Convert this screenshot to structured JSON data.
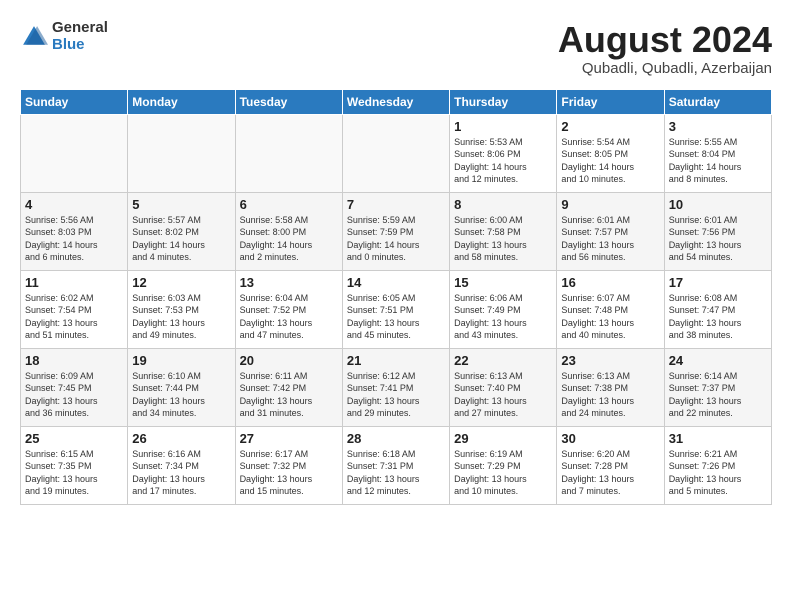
{
  "logo": {
    "general": "General",
    "blue": "Blue"
  },
  "title": "August 2024",
  "subtitle": "Qubadli, Qubadli, Azerbaijan",
  "weekdays": [
    "Sunday",
    "Monday",
    "Tuesday",
    "Wednesday",
    "Thursday",
    "Friday",
    "Saturday"
  ],
  "weeks": [
    [
      {
        "day": "",
        "info": ""
      },
      {
        "day": "",
        "info": ""
      },
      {
        "day": "",
        "info": ""
      },
      {
        "day": "",
        "info": ""
      },
      {
        "day": "1",
        "info": "Sunrise: 5:53 AM\nSunset: 8:06 PM\nDaylight: 14 hours\nand 12 minutes."
      },
      {
        "day": "2",
        "info": "Sunrise: 5:54 AM\nSunset: 8:05 PM\nDaylight: 14 hours\nand 10 minutes."
      },
      {
        "day": "3",
        "info": "Sunrise: 5:55 AM\nSunset: 8:04 PM\nDaylight: 14 hours\nand 8 minutes."
      }
    ],
    [
      {
        "day": "4",
        "info": "Sunrise: 5:56 AM\nSunset: 8:03 PM\nDaylight: 14 hours\nand 6 minutes."
      },
      {
        "day": "5",
        "info": "Sunrise: 5:57 AM\nSunset: 8:02 PM\nDaylight: 14 hours\nand 4 minutes."
      },
      {
        "day": "6",
        "info": "Sunrise: 5:58 AM\nSunset: 8:00 PM\nDaylight: 14 hours\nand 2 minutes."
      },
      {
        "day": "7",
        "info": "Sunrise: 5:59 AM\nSunset: 7:59 PM\nDaylight: 14 hours\nand 0 minutes."
      },
      {
        "day": "8",
        "info": "Sunrise: 6:00 AM\nSunset: 7:58 PM\nDaylight: 13 hours\nand 58 minutes."
      },
      {
        "day": "9",
        "info": "Sunrise: 6:01 AM\nSunset: 7:57 PM\nDaylight: 13 hours\nand 56 minutes."
      },
      {
        "day": "10",
        "info": "Sunrise: 6:01 AM\nSunset: 7:56 PM\nDaylight: 13 hours\nand 54 minutes."
      }
    ],
    [
      {
        "day": "11",
        "info": "Sunrise: 6:02 AM\nSunset: 7:54 PM\nDaylight: 13 hours\nand 51 minutes."
      },
      {
        "day": "12",
        "info": "Sunrise: 6:03 AM\nSunset: 7:53 PM\nDaylight: 13 hours\nand 49 minutes."
      },
      {
        "day": "13",
        "info": "Sunrise: 6:04 AM\nSunset: 7:52 PM\nDaylight: 13 hours\nand 47 minutes."
      },
      {
        "day": "14",
        "info": "Sunrise: 6:05 AM\nSunset: 7:51 PM\nDaylight: 13 hours\nand 45 minutes."
      },
      {
        "day": "15",
        "info": "Sunrise: 6:06 AM\nSunset: 7:49 PM\nDaylight: 13 hours\nand 43 minutes."
      },
      {
        "day": "16",
        "info": "Sunrise: 6:07 AM\nSunset: 7:48 PM\nDaylight: 13 hours\nand 40 minutes."
      },
      {
        "day": "17",
        "info": "Sunrise: 6:08 AM\nSunset: 7:47 PM\nDaylight: 13 hours\nand 38 minutes."
      }
    ],
    [
      {
        "day": "18",
        "info": "Sunrise: 6:09 AM\nSunset: 7:45 PM\nDaylight: 13 hours\nand 36 minutes."
      },
      {
        "day": "19",
        "info": "Sunrise: 6:10 AM\nSunset: 7:44 PM\nDaylight: 13 hours\nand 34 minutes."
      },
      {
        "day": "20",
        "info": "Sunrise: 6:11 AM\nSunset: 7:42 PM\nDaylight: 13 hours\nand 31 minutes."
      },
      {
        "day": "21",
        "info": "Sunrise: 6:12 AM\nSunset: 7:41 PM\nDaylight: 13 hours\nand 29 minutes."
      },
      {
        "day": "22",
        "info": "Sunrise: 6:13 AM\nSunset: 7:40 PM\nDaylight: 13 hours\nand 27 minutes."
      },
      {
        "day": "23",
        "info": "Sunrise: 6:13 AM\nSunset: 7:38 PM\nDaylight: 13 hours\nand 24 minutes."
      },
      {
        "day": "24",
        "info": "Sunrise: 6:14 AM\nSunset: 7:37 PM\nDaylight: 13 hours\nand 22 minutes."
      }
    ],
    [
      {
        "day": "25",
        "info": "Sunrise: 6:15 AM\nSunset: 7:35 PM\nDaylight: 13 hours\nand 19 minutes."
      },
      {
        "day": "26",
        "info": "Sunrise: 6:16 AM\nSunset: 7:34 PM\nDaylight: 13 hours\nand 17 minutes."
      },
      {
        "day": "27",
        "info": "Sunrise: 6:17 AM\nSunset: 7:32 PM\nDaylight: 13 hours\nand 15 minutes."
      },
      {
        "day": "28",
        "info": "Sunrise: 6:18 AM\nSunset: 7:31 PM\nDaylight: 13 hours\nand 12 minutes."
      },
      {
        "day": "29",
        "info": "Sunrise: 6:19 AM\nSunset: 7:29 PM\nDaylight: 13 hours\nand 10 minutes."
      },
      {
        "day": "30",
        "info": "Sunrise: 6:20 AM\nSunset: 7:28 PM\nDaylight: 13 hours\nand 7 minutes."
      },
      {
        "day": "31",
        "info": "Sunrise: 6:21 AM\nSunset: 7:26 PM\nDaylight: 13 hours\nand 5 minutes."
      }
    ]
  ]
}
